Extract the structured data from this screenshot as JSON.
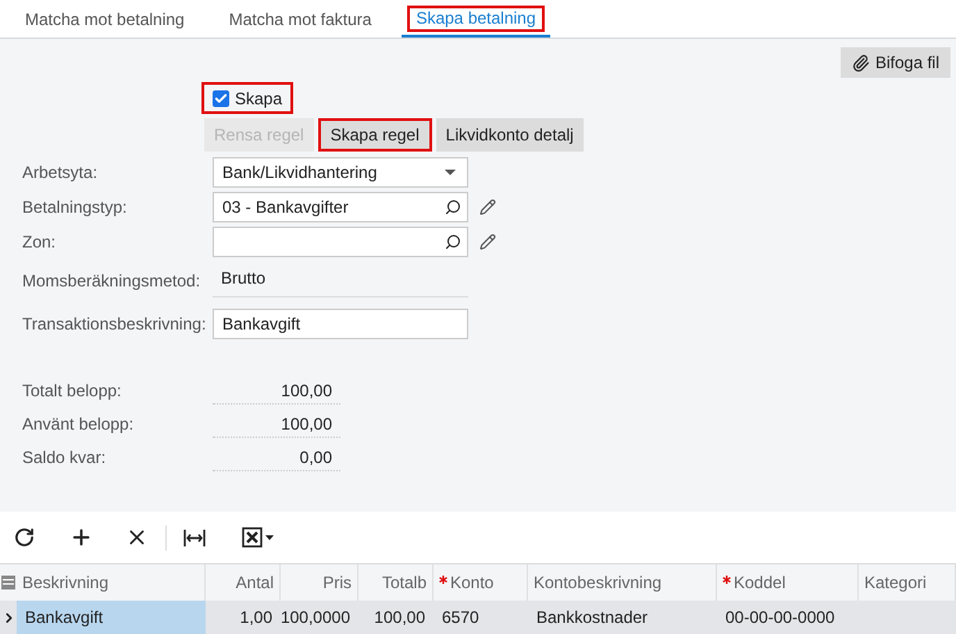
{
  "tabs": [
    {
      "label": "Matcha mot betalning",
      "selected": false,
      "highlighted": false
    },
    {
      "label": "Matcha mot faktura",
      "selected": false,
      "highlighted": false
    },
    {
      "label": "Skapa betalning",
      "selected": true,
      "highlighted": true
    }
  ],
  "attach_button": "Bifoga fil",
  "create_checkbox": {
    "label": "Skapa",
    "checked": true,
    "highlighted": true
  },
  "rule_buttons": [
    {
      "label": "Rensa regel",
      "disabled": true,
      "highlighted": false
    },
    {
      "label": "Skapa regel",
      "disabled": false,
      "highlighted": true
    },
    {
      "label": "Likvidkonto detalj",
      "disabled": false,
      "highlighted": false
    }
  ],
  "fields": [
    {
      "kind": "dropdown",
      "label": "Arbetsyta:",
      "value": "Bank/Likvidhantering"
    },
    {
      "kind": "lookup",
      "label": "Betalningstyp:",
      "value": "03 - Bankavgifter"
    },
    {
      "kind": "lookup",
      "label": "Zon:"
    },
    {
      "kind": "readonly",
      "label": "Momsberäkningsmetod:",
      "value": "Brutto"
    },
    {
      "kind": "text",
      "label": "Transaktionsbeskrivning:",
      "value": "Bankavgift"
    }
  ],
  "totals": [
    {
      "label": "Totalt belopp:",
      "value": "100,00"
    },
    {
      "label": "Använt belopp:",
      "value": "100,00"
    },
    {
      "label": "Saldo kvar:",
      "value": "0,00"
    }
  ],
  "table": {
    "columns": [
      {
        "label": "Beskrivning",
        "required": false,
        "kind": "text"
      },
      {
        "label": "Antal",
        "required": false,
        "kind": "number"
      },
      {
        "label": "Pris",
        "required": false,
        "kind": "number"
      },
      {
        "label": "Totalb",
        "required": false,
        "kind": "number"
      },
      {
        "label": "Konto",
        "required": true,
        "kind": "text"
      },
      {
        "label": "Kontobeskrivning",
        "required": false,
        "kind": "text"
      },
      {
        "label": "Koddel",
        "required": true,
        "kind": "text"
      },
      {
        "label": "Kategori",
        "required": false,
        "kind": "text"
      }
    ],
    "rows": [
      {
        "selected": true,
        "cells": [
          "Bankavgift",
          "1,00",
          "100,0000",
          "100,00",
          "6570",
          "Bankkostnader",
          "00-00-00-0000",
          ""
        ]
      }
    ]
  }
}
